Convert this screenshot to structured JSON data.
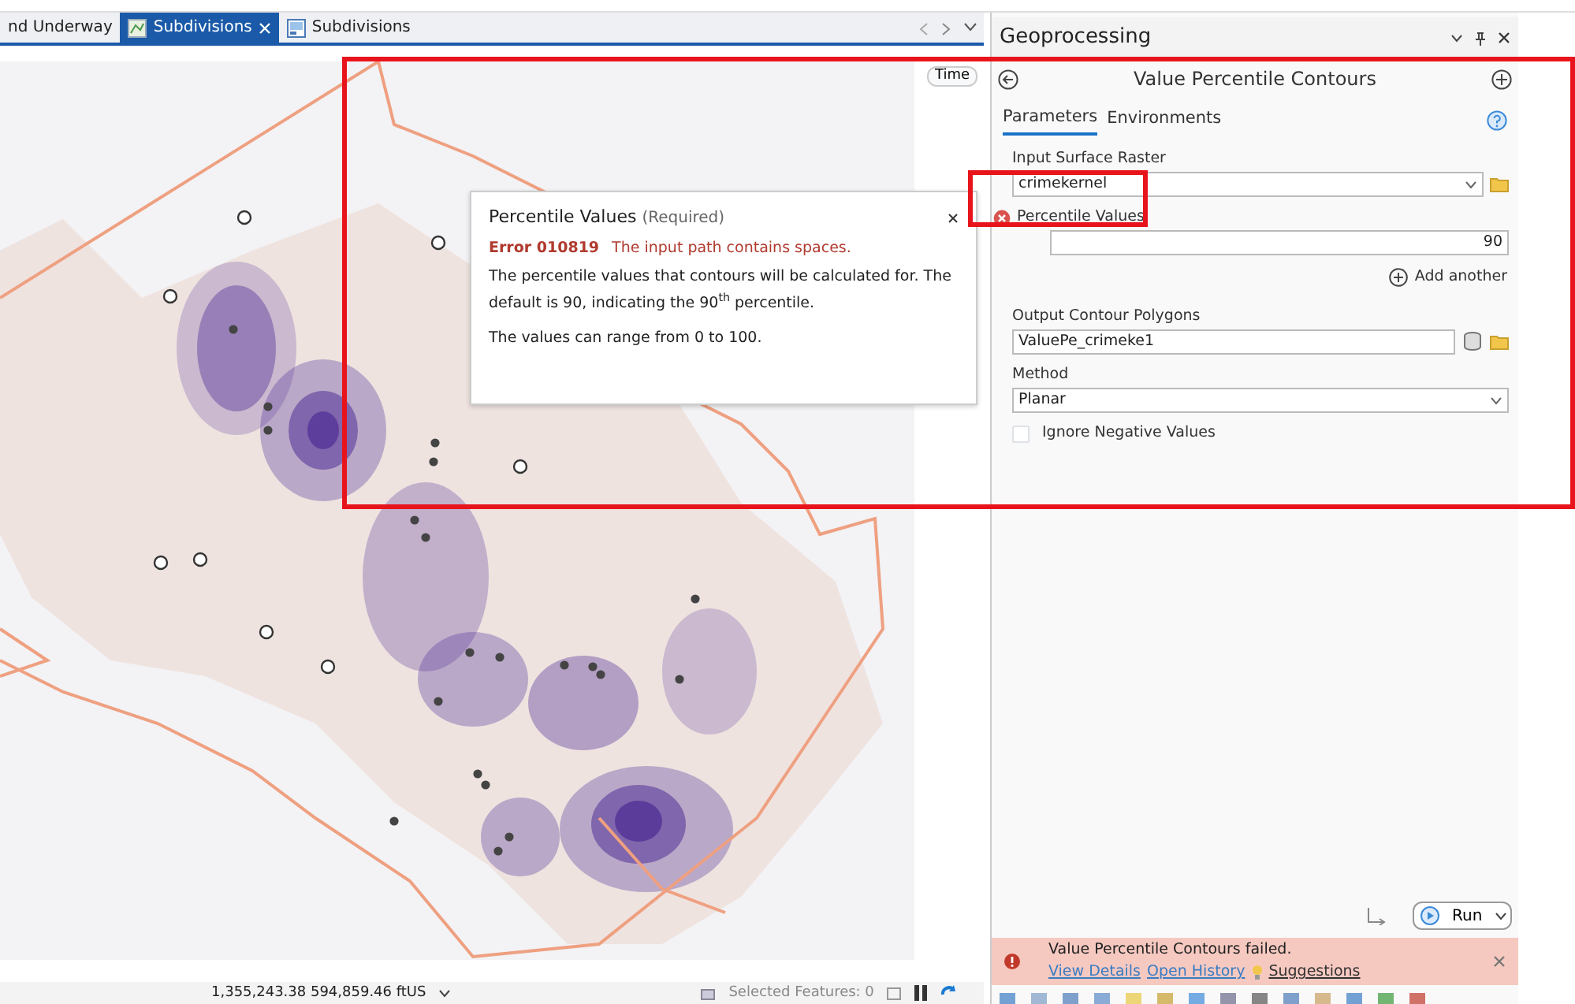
{
  "map_tabs": [
    {
      "label": "nd Underway",
      "selected": false,
      "closable": false,
      "kind": "plain"
    },
    {
      "label": "Subdivisions",
      "selected": true,
      "closable": true,
      "kind": "map"
    },
    {
      "label": "Subdivisions",
      "selected": false,
      "closable": false,
      "kind": "layout"
    }
  ],
  "map": {
    "time_button": "Time"
  },
  "tooltip": {
    "title": "Percentile Values",
    "qualifier": "(Required)",
    "error_code": "Error 010819",
    "error_message": "The input path contains spaces.",
    "description": "The percentile values that contours will be calculated for. The default is 90, indicating the 90$^{th}$ percentile.",
    "note": "The values can range from 0 to 100."
  },
  "status_bar": {
    "coordinates": "1,355,243.38 594,859.46 ftUS",
    "selected_features": "Selected Features: 0"
  },
  "geoprocessing": {
    "title": "Geoprocessing",
    "tool": "Value Percentile Contours",
    "tabs": [
      {
        "label": "Parameters",
        "selected": true
      },
      {
        "label": "Environments",
        "selected": false
      }
    ],
    "params": [
      {
        "kind": "dropdown",
        "label": "Input Surface Raster",
        "value": "crimekernel",
        "error": false
      },
      {
        "kind": "number",
        "label": "Percentile Values",
        "value": "90",
        "error": true
      },
      {
        "kind": "output",
        "label": "Output Contour Polygons",
        "value": "ValuePe_crimeke1",
        "error": false
      },
      {
        "kind": "select",
        "label": "Method",
        "value": "Planar",
        "error": false
      },
      {
        "kind": "checkbox",
        "label": "Ignore Negative Values",
        "checked": false
      }
    ],
    "add_another": "Add another",
    "run_button": "Run",
    "message": {
      "text": "Value Percentile Contours failed.",
      "links": [
        "View Details",
        "Open History"
      ],
      "suggestions": "Suggestions"
    }
  }
}
